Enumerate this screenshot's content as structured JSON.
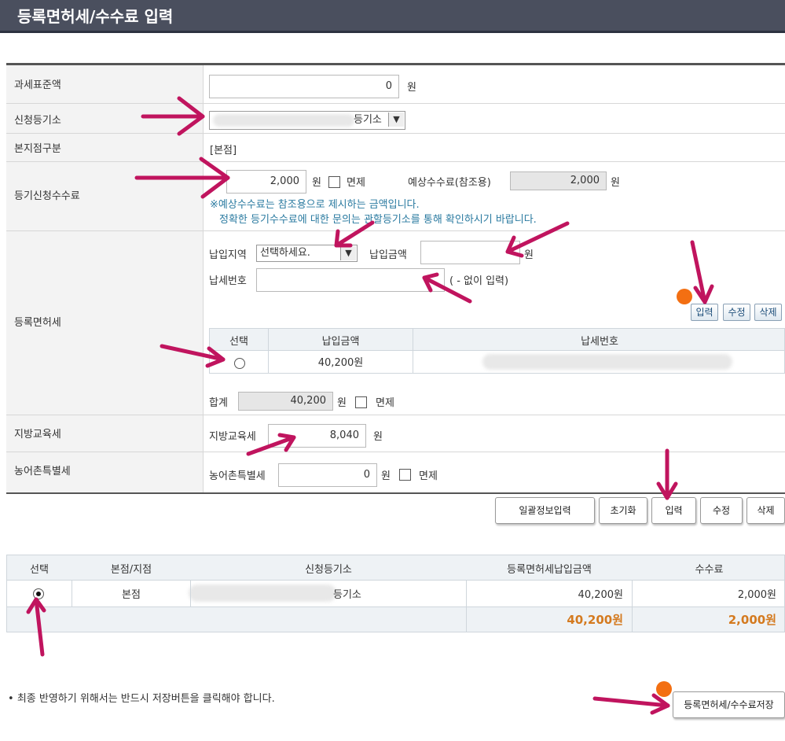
{
  "page": {
    "title": "등록면허세/수수료 입력"
  },
  "form": {
    "tax_base": {
      "label": "과세표준액",
      "value": "0",
      "unit": "원"
    },
    "registry": {
      "label": "신청등기소",
      "selected": "등기소"
    },
    "branch": {
      "label": "본지점구분",
      "value": "[본점]"
    },
    "fee": {
      "label": "등기신청수수료",
      "value": "2,000",
      "unit": "원",
      "exempt_label": "면제",
      "expected_label": "예상수수료(참조용)",
      "expected_value": "2,000",
      "expected_unit": "원",
      "note_line1": "※예상수수료는 참조용으로 제시하는 금액입니다.",
      "note_line2": "정확한 등기수수료에 대한 문의는 관할등기소를 통해 확인하시기 바랍니다."
    },
    "license_tax": {
      "label": "등록면허세",
      "region_label": "납입지역",
      "region_selected": "선택하세요.",
      "amount_label": "납입금액",
      "amount_unit": "원",
      "taxno_label": "납세번호",
      "taxno_hint": "( - 없이 입력)",
      "buttons": {
        "enter": "입력",
        "edit": "수정",
        "delete": "삭제"
      },
      "grid_headers": [
        "선택",
        "납입금액",
        "납세번호"
      ],
      "grid_rows": [
        {
          "amount": "40,200원"
        }
      ],
      "total_label": "합계",
      "total_value": "40,200",
      "total_unit": "원",
      "exempt_label": "면제"
    },
    "edu_tax": {
      "label": "지방교육세",
      "inner_label": "지방교육세",
      "value": "8,040",
      "unit": "원"
    },
    "farm_tax": {
      "label": "농어촌특별세",
      "inner_label": "농어촌특별세",
      "value": "0",
      "unit": "원",
      "exempt_label": "면제"
    }
  },
  "actions": {
    "bulk": "일괄정보입력",
    "reset": "초기화",
    "enter": "입력",
    "edit": "수정",
    "delete": "삭제"
  },
  "summary": {
    "headers": [
      "선택",
      "본점/지점",
      "신청등기소",
      "등록면허세납입금액",
      "수수료"
    ],
    "rows": [
      {
        "branch": "본점",
        "registry": "등기소",
        "tax": "40,200원",
        "fee": "2,000원"
      }
    ],
    "total_tax": "40,200원",
    "total_fee": "2,000원"
  },
  "footer": {
    "notice": "최종 반영하기 위해서는 반드시 저장버튼을 클릭해야 합니다.",
    "save": "등록면허세/수수료저장"
  },
  "colors": {
    "title_bg": "#4a4f5e",
    "annotation": "#c0145e",
    "marker": "#f36f12",
    "total": "#d47a1f"
  }
}
